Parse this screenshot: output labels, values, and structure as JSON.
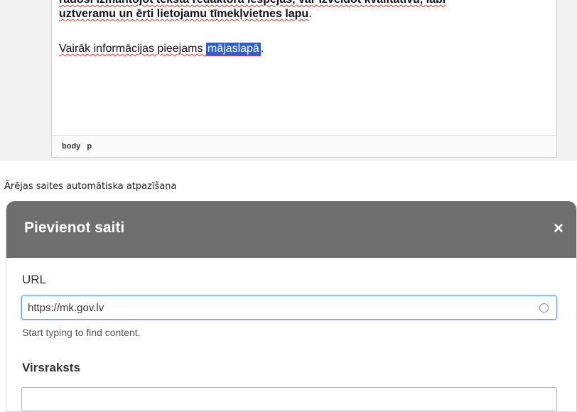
{
  "editor": {
    "line1": "radosi izmantojot teksta redaktora iespējas, var izveidot kvalitatīvu, labi",
    "line2": "uztveramu un ērti lietojamu tīmekļvietnes lapu",
    "line2_end": ".",
    "para_prefix": "Vairāk informācijas pieejams ",
    "para_link": "mājaslapā",
    "para_suffix": ".",
    "statusbar": [
      "body",
      "p"
    ]
  },
  "caption": "Ārējas saites automātiska atpazīšana",
  "dialog": {
    "title": "Pievienot saiti",
    "close_icon": "×",
    "url_label": "URL",
    "url_value": "https://mk.gov.lv",
    "url_help": "Start typing to find content.",
    "title_label": "Virsraksts",
    "title_value": ""
  }
}
